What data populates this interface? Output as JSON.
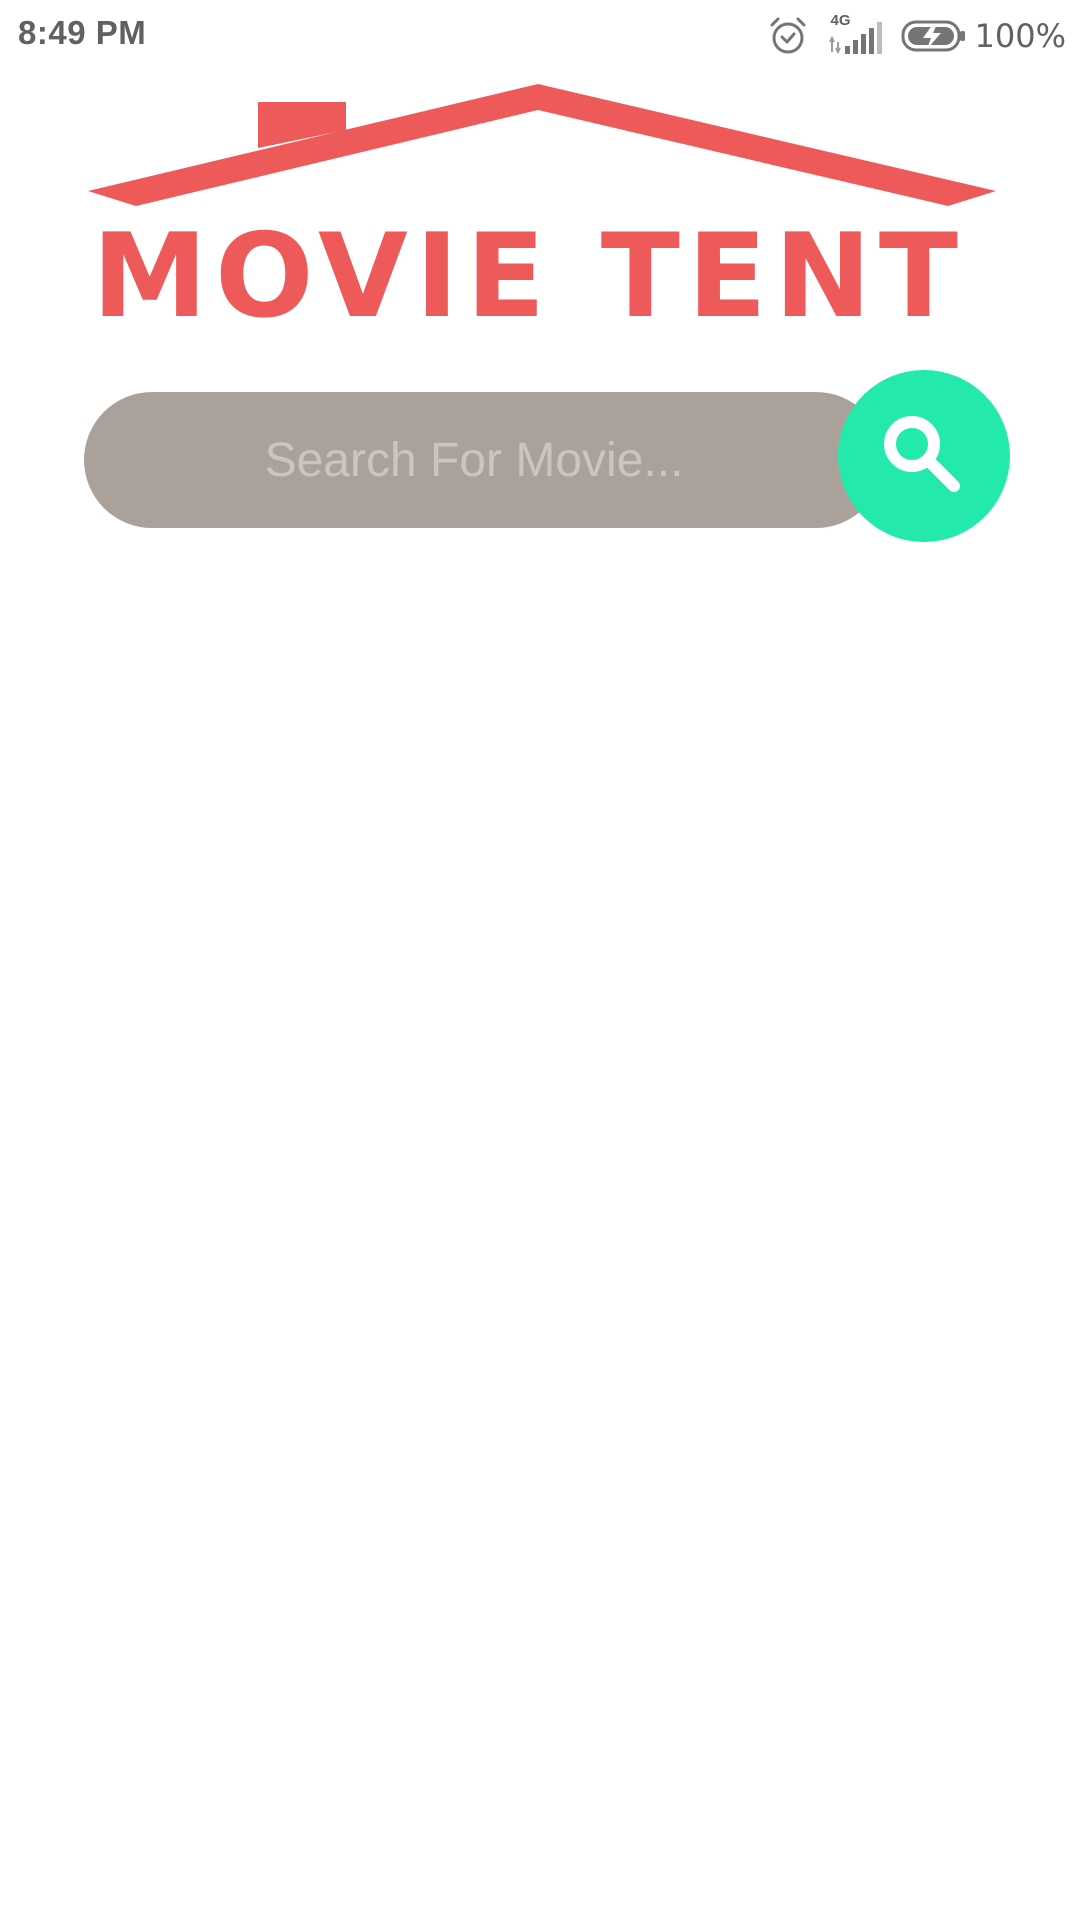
{
  "status_bar": {
    "time": "8:49 PM",
    "network_type": "4G",
    "battery_percent": "100%",
    "icons": [
      "alarm-icon",
      "signal-icon",
      "battery-charging-icon"
    ]
  },
  "logo": {
    "text": "MOVIE TENT",
    "icon": "house-roof-icon",
    "color": "#ee5a5a"
  },
  "search": {
    "placeholder": "Search For Movie...",
    "value": "",
    "button_icon": "search-icon",
    "bar_color": "#aaa19b",
    "button_color": "#24e9ad"
  }
}
